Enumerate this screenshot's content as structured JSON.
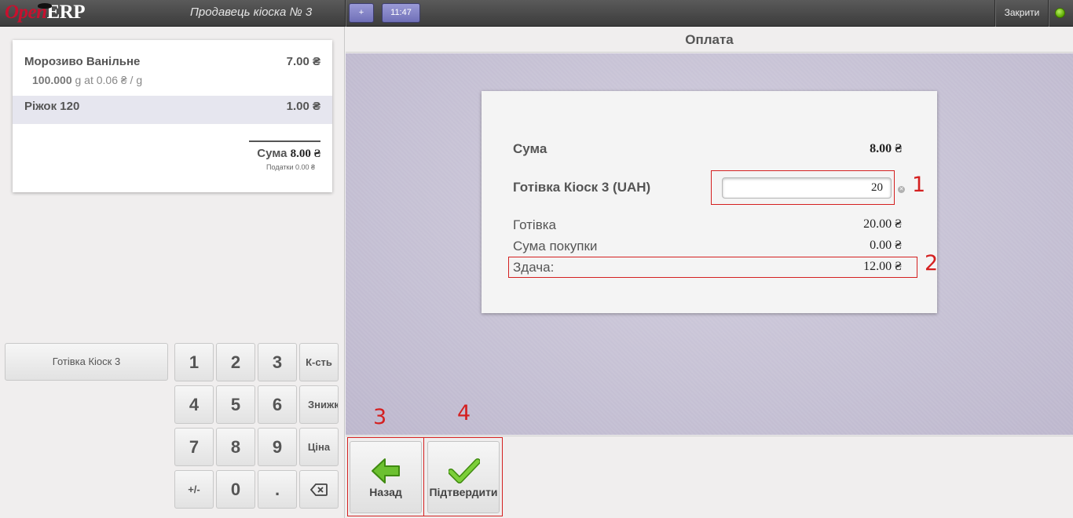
{
  "topbar": {
    "logo_part1": "Open",
    "logo_part2": "ERP",
    "cashier": "Продавець кіоска № 3",
    "add_label": "+",
    "time": "11:47",
    "close_label": "Закрити"
  },
  "order": {
    "lines": [
      {
        "name": "Морозиво Ванільне",
        "price": "7.00 ₴",
        "qty": "100.000",
        "unit_info": "g at 0.06 ₴ / g"
      },
      {
        "name": "Ріжок 120",
        "price": "1.00 ₴"
      }
    ],
    "total_label": "Сума",
    "total": "8.00 ₴",
    "taxes": "Податки 0.00 ₴"
  },
  "paypad": {
    "cash_button": "Готівка Кіоск 3"
  },
  "numpad": {
    "keys": [
      "1",
      "2",
      "3",
      "4",
      "5",
      "6",
      "7",
      "8",
      "9",
      "+/-",
      "0",
      "."
    ],
    "modes": [
      "К-сть",
      "Знижка",
      "Ціна"
    ],
    "backspace_icon": "backspace-icon"
  },
  "payment": {
    "title": "Оплата",
    "sum_label": "Сума",
    "sum_value": "8.00 ₴",
    "method_label": "Готівка Кіоск 3 (UAH)",
    "method_input": "20",
    "cash_label": "Готівка",
    "cash_value": "20.00 ₴",
    "purchase_label": "Сума покупки",
    "purchase_value": "0.00 ₴",
    "change_label": "Здача:",
    "change_value": "12.00 ₴"
  },
  "annotations": [
    "1",
    "2",
    "3",
    "4"
  ],
  "actions": {
    "back_label": "Назад",
    "back_icon": "arrow-left-icon",
    "validate_label": "Підтвердити",
    "validate_icon": "checkmark-icon"
  },
  "colors": {
    "accent_button": "#8080c8",
    "annotation_red": "#d42020",
    "status_online": "#6cc000"
  }
}
